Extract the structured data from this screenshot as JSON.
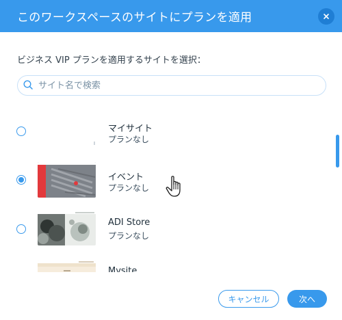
{
  "dialog": {
    "title": "このワークスペースのサイトにプランを適用",
    "subtitle": "ビジネス VIP プランを適用するサイトを選択：",
    "accent_color": "#3899ec"
  },
  "search": {
    "placeholder": "サイト名で検索",
    "value": ""
  },
  "sites": [
    {
      "name": "マイサイト",
      "plan": "プランなし",
      "selected": false,
      "thumbnail": "blank"
    },
    {
      "name": "イベント",
      "plan": "プランなし",
      "selected": true,
      "thumbnail": "event-photo"
    },
    {
      "name": "ADI Store",
      "plan": "プランなし",
      "selected": false,
      "thumbnail": "store-photo"
    },
    {
      "name": "Mysite",
      "plan": "",
      "selected": false,
      "thumbnail": "mysite-page"
    }
  ],
  "buttons": {
    "cancel": "キャンセル",
    "next": "次へ"
  },
  "icons": {
    "close": "close-icon",
    "search": "search-icon",
    "cursor": "hand-pointer-icon"
  }
}
